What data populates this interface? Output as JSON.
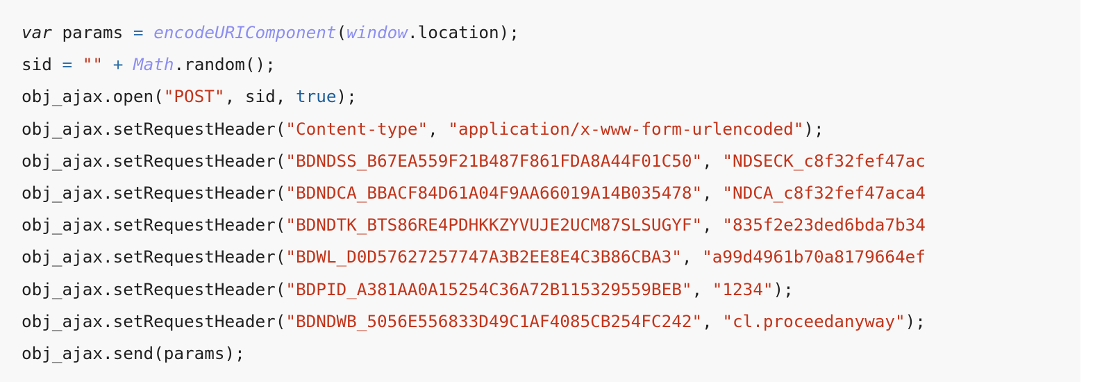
{
  "colors": {
    "background": "#f8f8f8",
    "text": "#1f1f1f",
    "string": "#c3341a",
    "operator": "#2f6fa8",
    "builtin_italic": "#8c8ef0",
    "boolean": "#1d5f9a"
  },
  "code": {
    "language": "javascript",
    "lines": [
      {
        "tokens": [
          {
            "type": "kw",
            "text": "var"
          },
          {
            "type": "plain",
            "text": " params "
          },
          {
            "type": "op",
            "text": "="
          },
          {
            "type": "plain",
            "text": " "
          },
          {
            "type": "fn",
            "text": "encodeURIComponent"
          },
          {
            "type": "plain",
            "text": "("
          },
          {
            "type": "fn",
            "text": "window"
          },
          {
            "type": "plain",
            "text": ".location);"
          }
        ]
      },
      {
        "tokens": [
          {
            "type": "plain",
            "text": "sid "
          },
          {
            "type": "op",
            "text": "="
          },
          {
            "type": "plain",
            "text": " "
          },
          {
            "type": "str",
            "text": "\"\""
          },
          {
            "type": "plain",
            "text": " "
          },
          {
            "type": "op",
            "text": "+"
          },
          {
            "type": "plain",
            "text": " "
          },
          {
            "type": "fn",
            "text": "Math"
          },
          {
            "type": "plain",
            "text": ".random();"
          }
        ]
      },
      {
        "tokens": [
          {
            "type": "plain",
            "text": "obj_ajax.open("
          },
          {
            "type": "str",
            "text": "\"POST\""
          },
          {
            "type": "plain",
            "text": ", sid, "
          },
          {
            "type": "bool",
            "text": "true"
          },
          {
            "type": "plain",
            "text": ");"
          }
        ]
      },
      {
        "tokens": [
          {
            "type": "plain",
            "text": "obj_ajax.setRequestHeader("
          },
          {
            "type": "str",
            "text": "\"Content-type\""
          },
          {
            "type": "plain",
            "text": ", "
          },
          {
            "type": "str",
            "text": "\"application/x-www-form-urlencoded\""
          },
          {
            "type": "plain",
            "text": ");"
          }
        ]
      },
      {
        "tokens": [
          {
            "type": "plain",
            "text": "obj_ajax.setRequestHeader("
          },
          {
            "type": "str",
            "text": "\"BDNDSS_B67EA559F21B487F861FDA8A44F01C50\""
          },
          {
            "type": "plain",
            "text": ", "
          },
          {
            "type": "str",
            "text": "\"NDSECK_c8f32fef47ac"
          }
        ]
      },
      {
        "tokens": [
          {
            "type": "plain",
            "text": "obj_ajax.setRequestHeader("
          },
          {
            "type": "str",
            "text": "\"BDNDCA_BBACF84D61A04F9AA66019A14B035478\""
          },
          {
            "type": "plain",
            "text": ", "
          },
          {
            "type": "str",
            "text": "\"NDCA_c8f32fef47aca4"
          }
        ]
      },
      {
        "tokens": [
          {
            "type": "plain",
            "text": "obj_ajax.setRequestHeader("
          },
          {
            "type": "str",
            "text": "\"BDNDTK_BTS86RE4PDHKKZYVUJE2UCM87SLSUGYF\""
          },
          {
            "type": "plain",
            "text": ", "
          },
          {
            "type": "str",
            "text": "\"835f2e23ded6bda7b34"
          }
        ]
      },
      {
        "tokens": [
          {
            "type": "plain",
            "text": "obj_ajax.setRequestHeader("
          },
          {
            "type": "str",
            "text": "\"BDWL_D0D57627257747A3B2EE8E4C3B86CBA3\""
          },
          {
            "type": "plain",
            "text": ", "
          },
          {
            "type": "str",
            "text": "\"a99d4961b70a8179664ef"
          }
        ]
      },
      {
        "tokens": [
          {
            "type": "plain",
            "text": "obj_ajax.setRequestHeader("
          },
          {
            "type": "str",
            "text": "\"BDPID_A381AA0A15254C36A72B115329559BEB\""
          },
          {
            "type": "plain",
            "text": ", "
          },
          {
            "type": "str",
            "text": "\"1234\""
          },
          {
            "type": "plain",
            "text": ");"
          }
        ]
      },
      {
        "tokens": [
          {
            "type": "plain",
            "text": "obj_ajax.setRequestHeader("
          },
          {
            "type": "str",
            "text": "\"BDNDWB_5056E556833D49C1AF4085CB254FC242\""
          },
          {
            "type": "plain",
            "text": ", "
          },
          {
            "type": "str",
            "text": "\"cl.proceedanyway\""
          },
          {
            "type": "plain",
            "text": ");"
          }
        ]
      },
      {
        "tokens": [
          {
            "type": "plain",
            "text": "obj_ajax.send(params);"
          }
        ]
      }
    ]
  }
}
